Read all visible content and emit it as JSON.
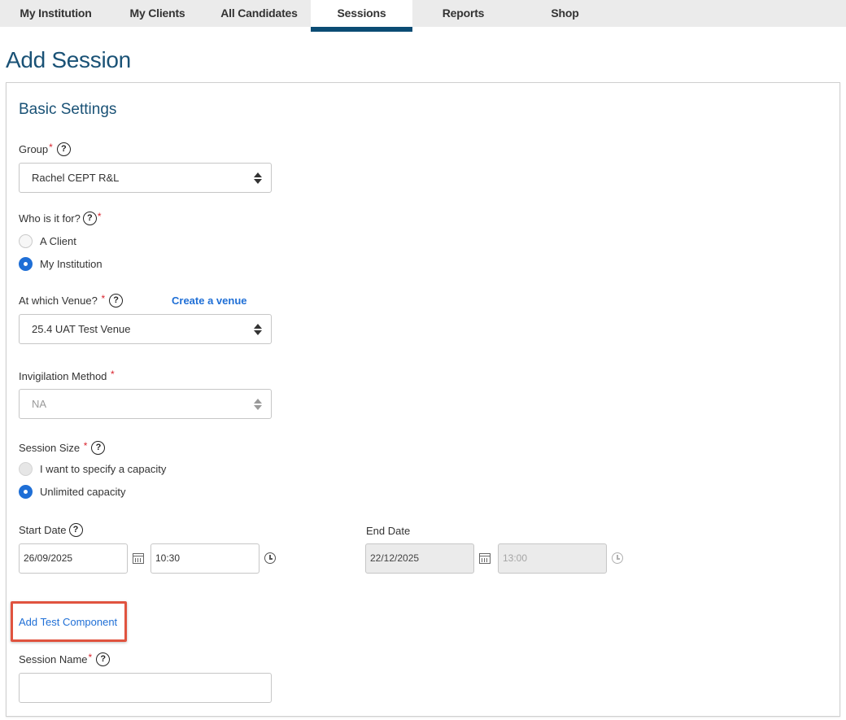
{
  "nav": {
    "tabs": [
      {
        "label": "My Institution"
      },
      {
        "label": "My Clients"
      },
      {
        "label": "All Candidates"
      },
      {
        "label": "Sessions"
      },
      {
        "label": "Reports"
      },
      {
        "label": "Shop"
      }
    ],
    "active_tab": "Sessions"
  },
  "page": {
    "title": "Add Session"
  },
  "basic_settings": {
    "title": "Basic Settings",
    "group": {
      "label": "Group",
      "required": "*",
      "help": "?",
      "value": "Rachel CEPT R&L"
    },
    "who_for": {
      "label": "Who is it for?",
      "required": "*",
      "help": "?",
      "options": [
        {
          "label": "A Client",
          "selected": false
        },
        {
          "label": "My Institution",
          "selected": true
        }
      ]
    },
    "venue": {
      "label": "At which Venue?",
      "required": "*",
      "help": "?",
      "create_link": "Create a venue",
      "value": "25.4 UAT Test Venue"
    },
    "invigilation": {
      "label": "Invigilation Method",
      "required": "*",
      "value": "NA",
      "disabled": true
    },
    "session_size": {
      "label": "Session Size",
      "required": "*",
      "help": "?",
      "options": [
        {
          "label": "I want to specify a capacity",
          "selected": false,
          "disabled": true
        },
        {
          "label": "Unlimited capacity",
          "selected": true
        }
      ]
    },
    "start": {
      "label": "Start Date",
      "help": "?",
      "date": "26/09/2025",
      "time": "10:30"
    },
    "end": {
      "label": "End Date",
      "date": "22/12/2025",
      "time": "13:00",
      "disabled": true
    },
    "add_test_component": "Add Test Component",
    "session_name": {
      "label": "Session Name",
      "required": "*",
      "help": "?",
      "value": ""
    }
  },
  "colors": {
    "nav_active": "#0b4c74",
    "title": "#1a5276",
    "link": "#1f6fd6",
    "required": "#d9232d",
    "highlight": "#e0533f"
  }
}
